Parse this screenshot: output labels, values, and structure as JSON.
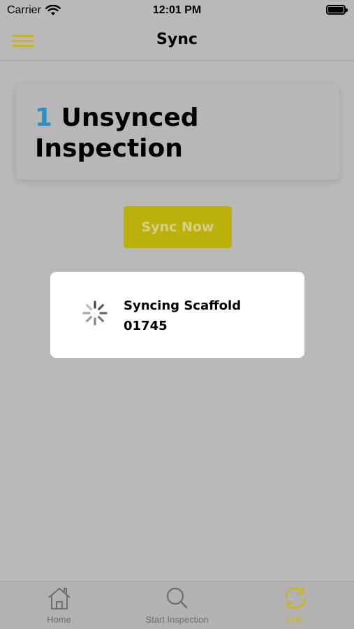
{
  "status_bar": {
    "carrier": "Carrier",
    "time": "12:01 PM",
    "icons": [
      "wifi-icon",
      "battery-icon"
    ]
  },
  "nav": {
    "title": "Sync",
    "menu_icon": "menu-icon"
  },
  "card": {
    "count": "1",
    "title_rest": " Unsynced Inspection"
  },
  "sync_button": {
    "label": "Sync Now"
  },
  "dialog": {
    "message": "Syncing Scaffold 01745",
    "icon": "spinner-icon"
  },
  "tabs": [
    {
      "label": "Home",
      "icon": "home-icon",
      "active": false
    },
    {
      "label": "Start Inspection",
      "icon": "search-icon",
      "active": false
    },
    {
      "label": "Sync",
      "icon": "sync-icon",
      "active": true
    }
  ],
  "colors": {
    "accent": "#c8b42a",
    "count_blue": "#2f8fc0",
    "overlay_bg": "#b9b9b9",
    "button": "#bcb00a"
  }
}
